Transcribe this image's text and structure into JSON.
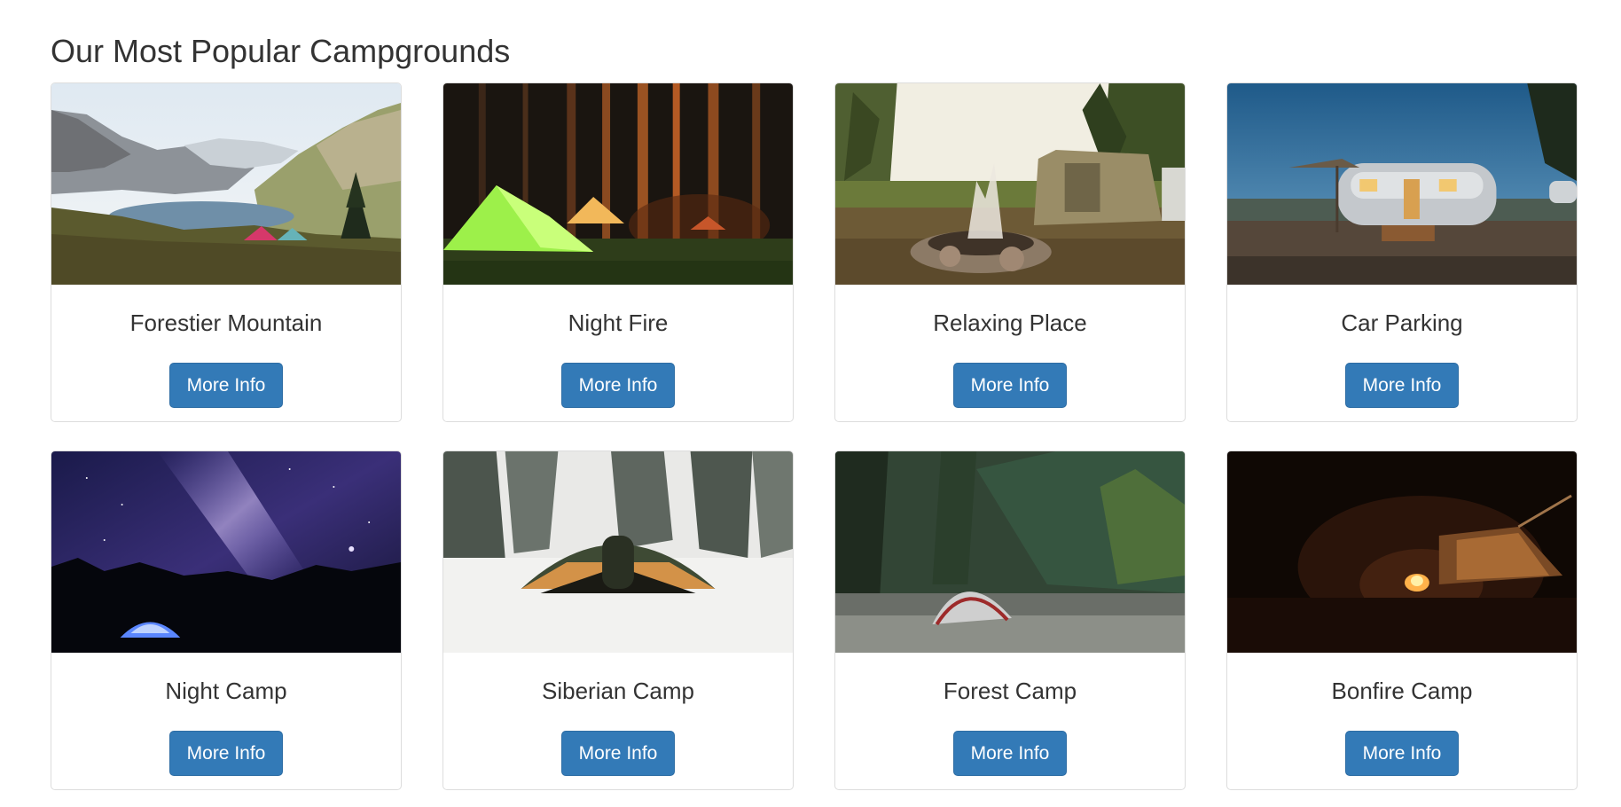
{
  "heading": "Our Most Popular Campgrounds",
  "button_label": "More Info",
  "colors": {
    "button": "#337ab7",
    "button_border": "#2e6da4",
    "card_border": "#dddddd",
    "text": "#333333"
  },
  "campgrounds": [
    {
      "name": "Forestier Mountain",
      "image": "mountain-lake-tents-image"
    },
    {
      "name": "Night Fire",
      "image": "glowing-tents-forest-night-image"
    },
    {
      "name": "Relaxing Place",
      "image": "campfire-tent-trailer-image"
    },
    {
      "name": "Car Parking",
      "image": "airstream-trailer-image"
    },
    {
      "name": "Night Camp",
      "image": "milky-way-tent-image"
    },
    {
      "name": "Siberian Camp",
      "image": "snow-tent-image"
    },
    {
      "name": "Forest Camp",
      "image": "forest-tent-image"
    },
    {
      "name": "Bonfire Camp",
      "image": "bonfire-tent-night-image"
    }
  ]
}
